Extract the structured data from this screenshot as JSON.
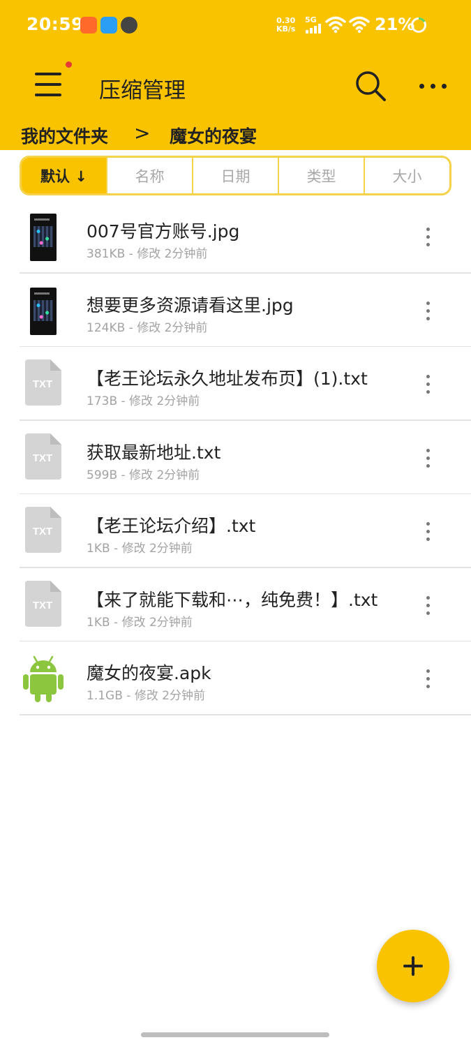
{
  "status_bar": {
    "time": "20:59",
    "net_speed_value": "0.30",
    "net_speed_unit": "KB/s",
    "network_type": "5G",
    "battery": "21%"
  },
  "app_bar": {
    "title": "压缩管理",
    "menu_icon": "hamburger-menu-icon",
    "search_icon": "search-icon",
    "more_icon": "more-horizontal-icon"
  },
  "breadcrumb": {
    "root": "我的文件夹",
    "separator": ">",
    "current": "魔女的夜宴"
  },
  "sort_tabs": [
    {
      "label": "默认 ↓",
      "active": true
    },
    {
      "label": "名称",
      "active": false
    },
    {
      "label": "日期",
      "active": false
    },
    {
      "label": "类型",
      "active": false
    },
    {
      "label": "大小",
      "active": false
    }
  ],
  "files": [
    {
      "name": "007号官方账号.jpg",
      "meta": "381KB - 修改 2分钟前",
      "icon": "image-thumbnail"
    },
    {
      "name": "想要更多资源请看这里.jpg",
      "meta": "124KB - 修改 2分钟前",
      "icon": "image-thumbnail"
    },
    {
      "name": "【老王论坛永久地址发布页】(1).txt",
      "meta": "173B - 修改 2分钟前",
      "icon": "txt-file-icon"
    },
    {
      "name": "获取最新地址.txt",
      "meta": "599B - 修改 2分钟前",
      "icon": "txt-file-icon"
    },
    {
      "name": "【老王论坛介绍】.txt",
      "meta": "1KB - 修改 2分钟前",
      "icon": "txt-file-icon"
    },
    {
      "name": "【来了就能下载和⋯，纯免费！】.txt",
      "meta": "1KB - 修改 2分钟前",
      "icon": "txt-file-icon"
    },
    {
      "name": "魔女的夜宴.apk",
      "meta": "1.1GB - 修改 2分钟前",
      "icon": "android-icon"
    }
  ],
  "txt_icon_label": "TXT",
  "fab_icon": "plus-icon",
  "colors": {
    "accent": "#f9c300",
    "android_green": "#8cc63f",
    "txt_icon_gray": "#d4d4d4"
  }
}
